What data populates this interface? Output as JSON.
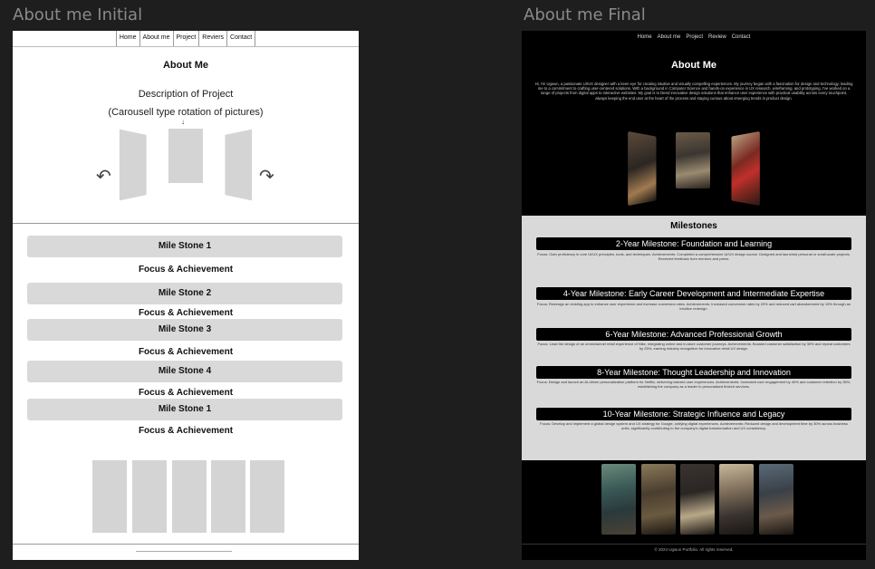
{
  "labels": {
    "initial": "About me Initial",
    "final": "About me Final"
  },
  "initial": {
    "nav": [
      "Home",
      "About me",
      "Project",
      "Reviers",
      "Contact"
    ],
    "title": "About Me",
    "description": "Description of Project",
    "carousel_label": "(Carousell type rotation of pictures)",
    "milestones": [
      "Mile Stone 1",
      "Mile Stone 2",
      "Mile Stone 3",
      "Mile Stone 4",
      "Mile Stone 1"
    ],
    "focus_label": "Focus & Achievement"
  },
  "final": {
    "nav": [
      "Home",
      "About me",
      "Project",
      "Review",
      "Contact"
    ],
    "title": "About Me",
    "bio": "Hi, I'm Ugwun, a passionate UI/UX designer with a keen eye for creating intuitive and visually compelling experiences. My journey began with a fascination for design and technology, leading me to a commitment to crafting user-centered solutions. With a background in Computer Science and hands-on experience in UX research, wireframing, and prototyping, I've worked on a range of projects from digital apps to interactive websites. My goal is to blend innovative design solutions that enhance user experience with practical usability across every touchpoint, always keeping the end user at the heart of the process and staying curious about emerging trends in product design.",
    "milestones_heading": "Milestones",
    "milestones": [
      {
        "title": "2-Year Milestone: Foundation and Learning",
        "detail": "Focus: Gain proficiency in core UI/UX principles, tools, and techniques. Achievements: Completed a comprehensive UI/UX design course. Designed and launched personal or small-scale projects. Received feedback from mentors and peers."
      },
      {
        "title": "4-Year Milestone: Early Career Development and Intermediate Expertise",
        "detail": "Focus: Redesign an existing app to enhance user experience and increase conversion rates. Achievements: Increased conversion rates by 20% and reduced cart abandonment by 15% through an intuitive redesign."
      },
      {
        "title": "6-Year Milestone: Advanced Professional Growth",
        "detail": "Focus: Lead the design of an omnichannel retail experience of Nike, integrating online and in-store customer journeys. Achievements: Boosted customer satisfaction by 30% and repeat customers by 25%, earning industry recognition for innovative retail UX design."
      },
      {
        "title": "8-Year Milestone: Thought Leadership and Innovation",
        "detail": "Focus: Design and launch an AI-driven personalization platform for Netflix, delivering tailored user experiences. Achievements: Increased user engagement by 40% and customer retention by 35%, establishing the company as a leader in personalized fintech services."
      },
      {
        "title": "10-Year Milestone: Strategic Influence and Legacy",
        "detail": "Focus: Develop and implement a global design system and UX strategy for Google, unifying digital experiences. Achievements: Reduced design and development time by 30% across business units, significantly contributing to the company's digital transformation and UX consistency."
      }
    ],
    "footer": "© 2024 Ugwun Portfolio. All rights reserved."
  },
  "colors": {
    "canvas": "#1e1e1e",
    "final_bg": "#000000",
    "milestone_section": "#d9d9d9",
    "placeholder": "#d4d4d4"
  }
}
